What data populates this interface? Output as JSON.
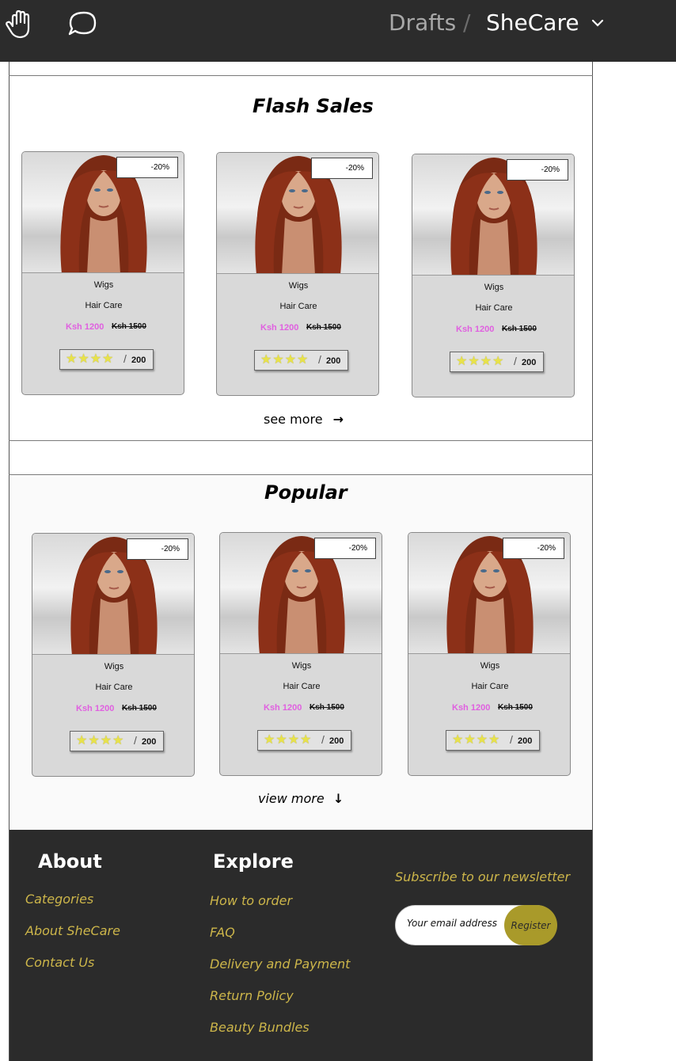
{
  "topbar": {
    "breadcrumb_parent": "Drafts",
    "breadcrumb_sep": "/",
    "project_name": "SheCare",
    "icons": [
      "hand-icon",
      "comment-icon",
      "chevron-down-icon"
    ]
  },
  "flash_sales": {
    "title": "Flash Sales",
    "more_label": "see more",
    "more_icon": "→",
    "cards": [
      {
        "badge": "-20%",
        "category": "Wigs",
        "subcategory": "Hair Care",
        "price": "Ksh 1200",
        "old_price": "Ksh 1500",
        "stars": "★★★★",
        "rating_count": "200"
      },
      {
        "badge": "-20%",
        "category": "Wigs",
        "subcategory": "Hair Care",
        "price": "Ksh 1200",
        "old_price": "Ksh 1500",
        "stars": "★★★★",
        "rating_count": "200"
      },
      {
        "badge": "-20%",
        "category": "Wigs",
        "subcategory": "Hair Care",
        "price": "Ksh 1200",
        "old_price": "Ksh 1500",
        "stars": "★★★★",
        "rating_count": "200"
      }
    ]
  },
  "popular": {
    "title": "Popular",
    "more_label": "view more",
    "more_icon": "↓",
    "cards": [
      {
        "badge": "-20%",
        "category": "Wigs",
        "subcategory": "Hair Care",
        "price": "Ksh 1200",
        "old_price": "Ksh 1500",
        "stars": "★★★★",
        "rating_count": "200"
      },
      {
        "badge": "-20%",
        "category": "Wigs",
        "subcategory": "Hair Care",
        "price": "Ksh 1200",
        "old_price": "Ksh 1500",
        "stars": "★★★★",
        "rating_count": "200"
      },
      {
        "badge": "-20%",
        "category": "Wigs",
        "subcategory": "Hair Care",
        "price": "Ksh 1200",
        "old_price": "Ksh 1500",
        "stars": "★★★★",
        "rating_count": "200"
      }
    ]
  },
  "footer": {
    "about_title": "About",
    "about_links": [
      "Categories",
      "About SheCare",
      "Contact Us"
    ],
    "explore_title": "Explore",
    "explore_links": [
      "How to order",
      "FAQ",
      "Delivery and Payment",
      "Return Policy",
      "Beauty Bundles"
    ],
    "newsletter_label": "Subscribe to our newsletter",
    "email_placeholder": "Your email address",
    "register_label": "Register"
  },
  "colors": {
    "topbar_bg": "#2c2c2c",
    "footer_bg": "#2b2b2b",
    "accent_gold": "#cdb64a",
    "register_bg": "#a99a2a",
    "price_pink": "#e060e0",
    "star_yellow": "#e8e24a",
    "card_bg": "#d9d9d9"
  }
}
